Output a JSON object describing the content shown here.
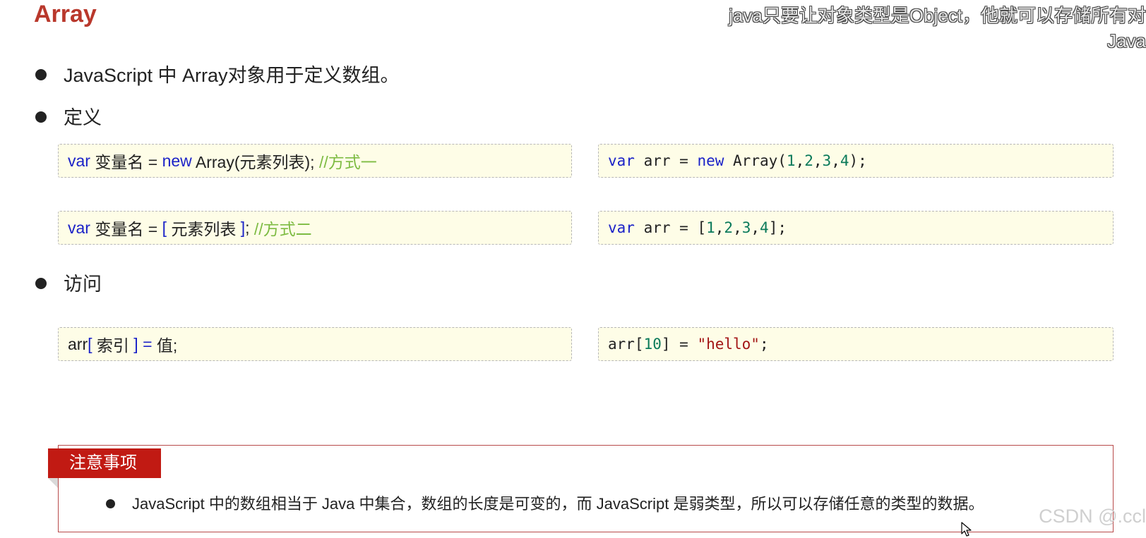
{
  "header": {
    "title": "Array",
    "subtitle_line1": "java只要让对象类型是Object，他就可以存储所有对",
    "subtitle_line2": "Java"
  },
  "bullets": {
    "intro": "JavaScript 中 Array对象用于定义数组。",
    "define": "定义",
    "access": "访问"
  },
  "definition": {
    "syntax1": {
      "kw": "var",
      "name": " 变量名 = ",
      "new": "new",
      "rest": " Array(元素列表); ",
      "comment": "//方式一"
    },
    "syntax2": {
      "kw": "var",
      "name": " 变量名 = ",
      "open": "[",
      "mid": " 元素列表 ",
      "close": "]",
      "semi": "; ",
      "comment": "//方式二"
    },
    "example1": {
      "kw": "var",
      "a": " arr = ",
      "new": "new",
      "b": " Array(",
      "n1": "1",
      "c1": ",",
      "n2": "2",
      "c2": ",",
      "n3": "3",
      "c3": ",",
      "n4": "4",
      "end": ");"
    },
    "example2": {
      "kw": "var",
      "a": " arr = [",
      "n1": "1",
      "c1": ",",
      "n2": "2",
      "c2": ",",
      "n3": "3",
      "c3": ",",
      "n4": "4",
      "end": "];"
    }
  },
  "access": {
    "syntax": {
      "a": "arr",
      "open": "[",
      "mid": " 索引 ",
      "close": "]",
      "eq": " = ",
      "b": "值;"
    },
    "example": {
      "a": "arr[",
      "n": "10",
      "b": "] = ",
      "s": "\"hello\"",
      "end": ";"
    }
  },
  "note": {
    "tag": "注意事项",
    "item": "JavaScript 中的数组相当于 Java 中集合，数组的长度是可变的，而 JavaScript 是弱类型，所以可以存储任意的类型的数据。"
  },
  "watermark": "CSDN @.ccl",
  "colors": {
    "title": "#b9382c",
    "keyword": "#1b22c8",
    "number": "#0a7a5a",
    "string": "#a31515",
    "comment": "#7dbb42",
    "code_bg": "#fefde7",
    "note_tag_bg": "#c11a13",
    "note_border": "#b84a4a"
  },
  "icons": {
    "cursor": "mouse-pointer-icon"
  }
}
